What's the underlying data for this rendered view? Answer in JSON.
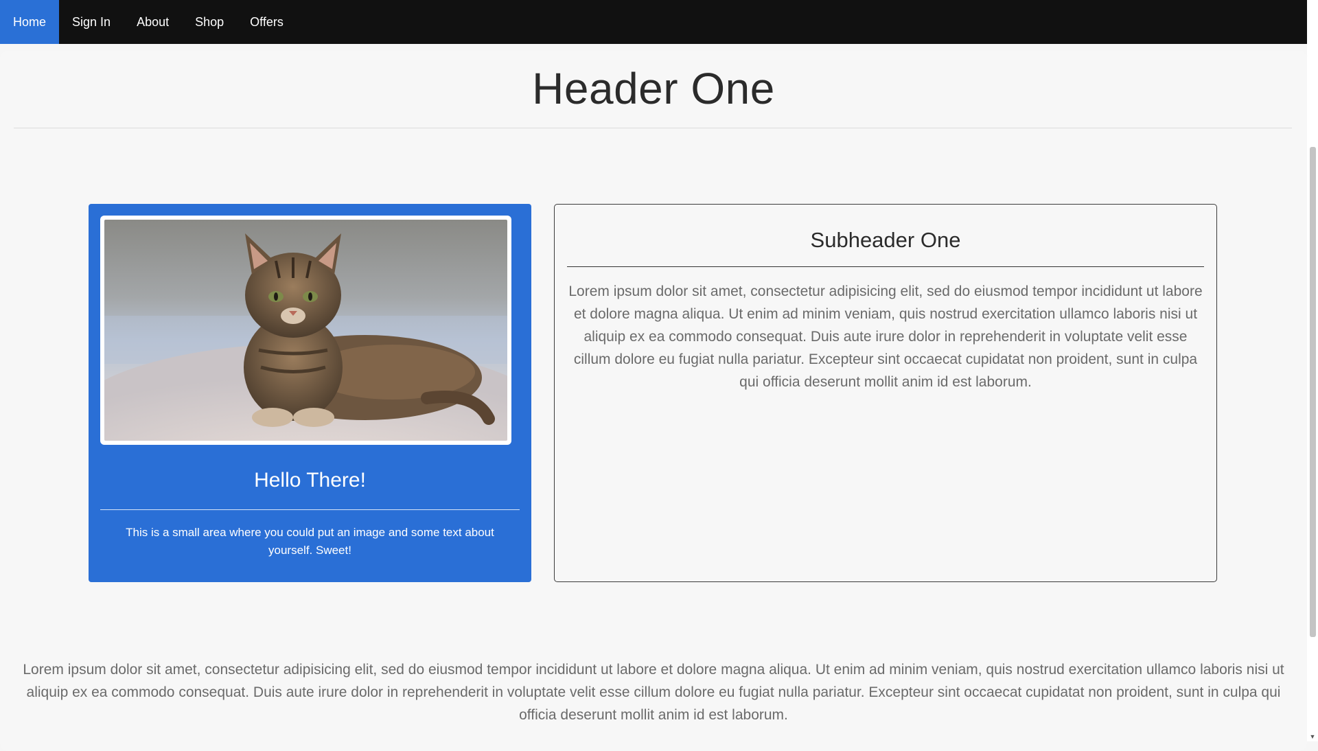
{
  "nav": {
    "items": [
      {
        "label": "Home",
        "active": true
      },
      {
        "label": "Sign In",
        "active": false
      },
      {
        "label": "About",
        "active": false
      },
      {
        "label": "Shop",
        "active": false
      },
      {
        "label": "Offers",
        "active": false
      }
    ],
    "background": "#111111",
    "active_color": "#2a70d6"
  },
  "page": {
    "title": "Header One"
  },
  "profile_card": {
    "image": "tabby-cat-photo",
    "heading": "Hello There!",
    "text": "This is a small area where you could put an image and some text about yourself. Sweet!",
    "background": "#2a6fd6"
  },
  "content_card": {
    "heading": "Subheader One",
    "text": "Lorem ipsum dolor sit amet, consectetur adipisicing elit, sed do eiusmod tempor incididunt ut labore et dolore magna aliqua. Ut enim ad minim veniam, quis nostrud exercitation ullamco laboris nisi ut aliquip ex ea commodo consequat. Duis aute irure dolor in reprehenderit in voluptate velit esse cillum dolore eu fugiat nulla pariatur. Excepteur sint occaecat cupidatat non proident, sunt in culpa qui officia deserunt mollit anim id est laborum."
  },
  "footer": {
    "text": "Lorem ipsum dolor sit amet, consectetur adipisicing elit, sed do eiusmod tempor incididunt ut labore et dolore magna aliqua. Ut enim ad minim veniam, quis nostrud exercitation ullamco laboris nisi ut aliquip ex ea commodo consequat. Duis aute irure dolor in reprehenderit in voluptate velit esse cillum dolore eu fugiat nulla pariatur. Excepteur sint occaecat cupidatat non proident, sunt in culpa qui officia deserunt mollit anim id est laborum."
  }
}
